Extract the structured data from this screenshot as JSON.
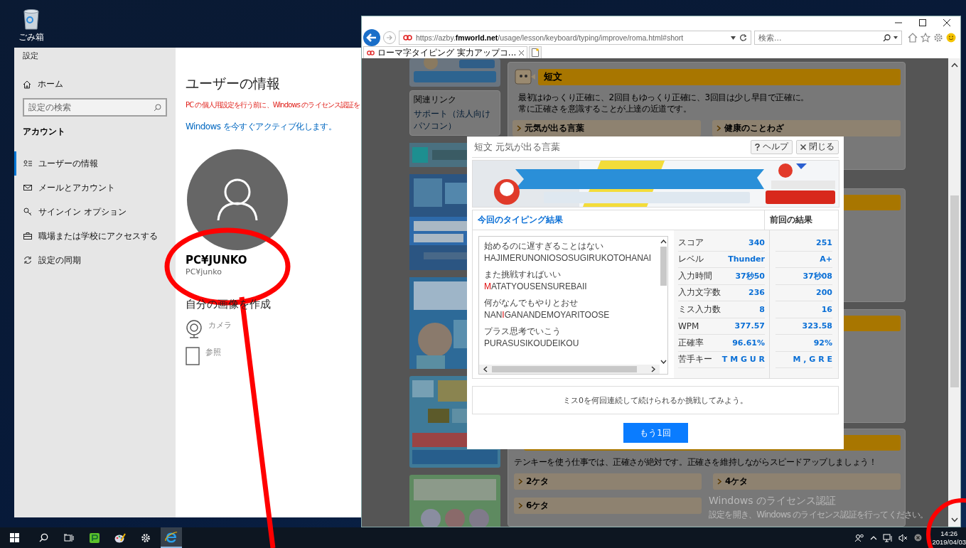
{
  "desktop": {
    "icons": [
      {
        "label": "ごみ箱"
      }
    ]
  },
  "settings": {
    "title": "設定",
    "home": "ホーム",
    "search_placeholder": "設定の検索",
    "section": "アカウント",
    "items": [
      {
        "label": "ユーザーの情報",
        "selected": true
      },
      {
        "label": "メールとアカウント",
        "selected": false
      },
      {
        "label": "サインイン オプション",
        "selected": false
      },
      {
        "label": "職場または学校にアクセスする",
        "selected": false
      },
      {
        "label": "設定の同期",
        "selected": false
      }
    ],
    "heading": "ユーザーの情報",
    "warning": "PC の個人用設定を行う前に、Windows のライセンス認証を",
    "activate_link": "Windows を今すぐアクティブ化します。",
    "user_name": "PC¥JUNKO",
    "user_account": "PC¥junko",
    "picture_heading": "自分の画像を作成",
    "picture_options": [
      {
        "label": "カメラ"
      },
      {
        "label": "参照"
      }
    ]
  },
  "browser": {
    "url": "https://azby.**fmworld.net**/usage/lesson/keyboard/typing/improve/roma.html#short",
    "search_placeholder": "検索...",
    "tabs": [
      {
        "title": "ローマ字タイピング 実力アップコ...",
        "selected": true
      }
    ]
  },
  "page": {
    "links_title": "関連リンク",
    "links": [
      "サポート（法人向けパソコン）"
    ],
    "top_section": {
      "title": "短文",
      "description": [
        "最初はゆっくり正確に、2回目もゆっくり正確に、3回目は少し早目で正確に。",
        "常に正確さを意識することが上達の近道です。"
      ],
      "links": [
        "元気が出る言葉",
        "健康のことわざ"
      ]
    },
    "bottom_section": {
      "description": "テンキーを使う仕事では、正確さが絶対です。正確さを維持しながらスピードアップしましょう！",
      "links": [
        "2ケタ",
        "4ケタ",
        "6ケタ"
      ]
    }
  },
  "dialog": {
    "title": "短文 元気が出る言葉",
    "help": "ヘルプ",
    "close": "閉じる",
    "current_title": "今回のタイピング結果",
    "previous_title": "前回の結果",
    "sentences": [
      {
        "japanese": "始めるのに遅すぎることはない",
        "romaji": [
          {
            "text": "HAJIMERUNONIOSOSUGIRUKOTOHANAI",
            "miss": false
          }
        ]
      },
      {
        "japanese": "また挑戦すればいい",
        "romaji": [
          {
            "text": "M",
            "miss": true
          },
          {
            "text": "ATATYOUSENSUREBAII",
            "miss": false
          }
        ]
      },
      {
        "japanese": "何がなんでもやりとおせ",
        "romaji": [
          {
            "text": "NAN",
            "miss": false
          },
          {
            "text": "I",
            "miss": true
          },
          {
            "text": "GANANDEMOYARITOOSE",
            "miss": false
          }
        ]
      },
      {
        "japanese": "プラス思考でいこう",
        "romaji": [
          {
            "text": "PURASUSIKOUDEIKOU",
            "miss": false
          }
        ]
      }
    ],
    "stats": [
      {
        "label": "スコア",
        "current": "340",
        "previous": "251"
      },
      {
        "label": "レベル",
        "current": "Thunder",
        "previous": "A+"
      },
      {
        "label": "入力時間",
        "current": "37秒50",
        "previous": "37秒08"
      },
      {
        "label": "入力文字数",
        "current": "236",
        "previous": "200"
      },
      {
        "label": "ミス入力数",
        "current": "8",
        "previous": "16"
      },
      {
        "label": "WPM",
        "current": "377.57",
        "previous": "323.58"
      },
      {
        "label": "正確率",
        "current": "96.61%",
        "previous": "92%"
      },
      {
        "label": "苦手キー",
        "current": "T M G U R",
        "previous": "M , G R E"
      }
    ],
    "message": "ミス0を何回連続して続けられるか挑戦してみよう。",
    "retry_button": "もう1回"
  },
  "activation_notice": {
    "title": "Windows のライセンス認証",
    "text": "設定を開き、Windows のライセンス認証を行ってください。"
  },
  "taskbar": {
    "apps": [
      {
        "kind": "start",
        "active": false
      },
      {
        "kind": "search",
        "active": false
      },
      {
        "kind": "taskview",
        "active": false
      },
      {
        "kind": "app",
        "active": false
      },
      {
        "kind": "paint",
        "active": false
      },
      {
        "kind": "settings",
        "active": false
      },
      {
        "kind": "ie",
        "active": true
      }
    ],
    "clock": {
      "time": "14:26",
      "date": "2019/04/03"
    }
  }
}
